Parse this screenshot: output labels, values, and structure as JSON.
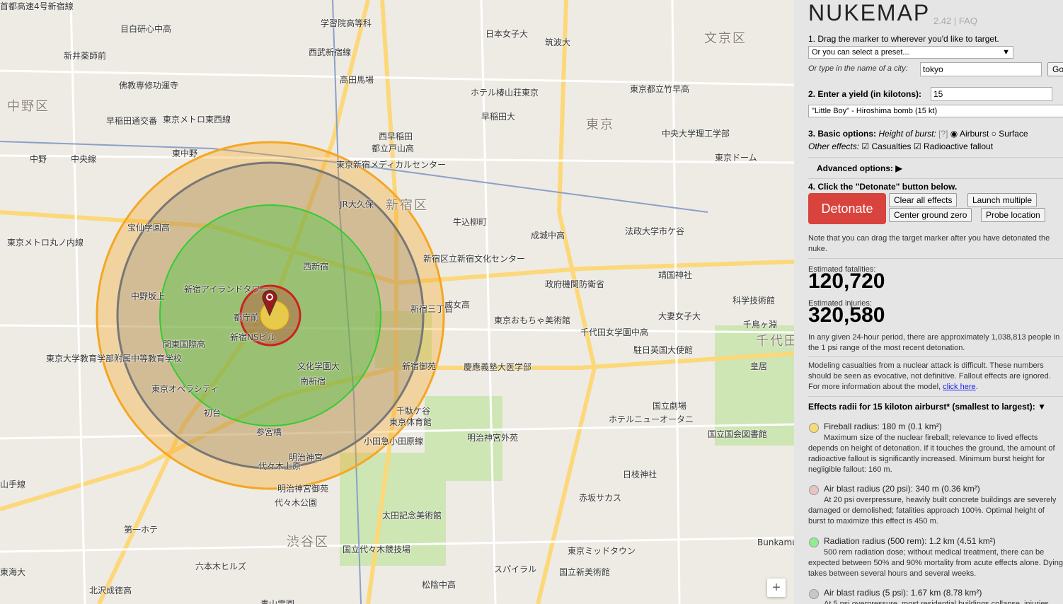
{
  "map": {
    "labels": [
      {
        "text": "中野区",
        "cls": "district"
      },
      {
        "text": "新宿区",
        "cls": "district"
      },
      {
        "text": "文京区",
        "cls": "district"
      },
      {
        "text": "渋谷区",
        "cls": "district"
      },
      {
        "text": "東京",
        "cls": "district"
      },
      {
        "text": "千代田",
        "cls": "district"
      },
      {
        "text": "目白研心中高",
        "cls": ""
      },
      {
        "text": "学習院高等科",
        "cls": ""
      },
      {
        "text": "日本女子大",
        "cls": ""
      },
      {
        "text": "筑波大",
        "cls": ""
      },
      {
        "text": "西武新宿線",
        "cls": ""
      },
      {
        "text": "新井薬師前",
        "cls": ""
      },
      {
        "text": "高田馬場",
        "cls": ""
      },
      {
        "text": "早稲田通交番",
        "cls": ""
      },
      {
        "text": "佛教専修功運寺",
        "cls": ""
      },
      {
        "text": "東京メトロ東西線",
        "cls": ""
      },
      {
        "text": "ホテル椿山荘東京",
        "cls": ""
      },
      {
        "text": "東京都立竹早高",
        "cls": ""
      },
      {
        "text": "早稲田大",
        "cls": ""
      },
      {
        "text": "中央大学理工学部",
        "cls": ""
      },
      {
        "text": "東京ドーム",
        "cls": ""
      },
      {
        "text": "都立戸山高",
        "cls": ""
      },
      {
        "text": "西早稲田",
        "cls": ""
      },
      {
        "text": "東中野",
        "cls": ""
      },
      {
        "text": "中央線",
        "cls": ""
      },
      {
        "text": "中野",
        "cls": ""
      },
      {
        "text": "東京新宿メディカルセンター",
        "cls": ""
      },
      {
        "text": "JR大久保",
        "cls": ""
      },
      {
        "text": "宝仙学園高",
        "cls": ""
      },
      {
        "text": "成城中高",
        "cls": ""
      },
      {
        "text": "牛込柳町",
        "cls": ""
      },
      {
        "text": "法政大学市ケ谷",
        "cls": ""
      },
      {
        "text": "靖国神社",
        "cls": ""
      },
      {
        "text": "東京メトロ丸ノ内線",
        "cls": ""
      },
      {
        "text": "新宿アイランドタワー",
        "cls": ""
      },
      {
        "text": "新宿区立新宿文化センター",
        "cls": ""
      },
      {
        "text": "政府機関防衛省",
        "cls": ""
      },
      {
        "text": "中野坂上",
        "cls": ""
      },
      {
        "text": "西新宿",
        "cls": ""
      },
      {
        "text": "都庁前",
        "cls": ""
      },
      {
        "text": "新宿三丁目",
        "cls": ""
      },
      {
        "text": "成女高",
        "cls": ""
      },
      {
        "text": "東京おもちゃ美術館",
        "cls": ""
      },
      {
        "text": "科学技術館",
        "cls": ""
      },
      {
        "text": "大妻女子大",
        "cls": ""
      },
      {
        "text": "千鳥ヶ淵",
        "cls": ""
      },
      {
        "text": "関東国際高",
        "cls": ""
      },
      {
        "text": "新宿NSビル",
        "cls": ""
      },
      {
        "text": "文化学園大",
        "cls": ""
      },
      {
        "text": "新宿御苑",
        "cls": ""
      },
      {
        "text": "慶應義塾大医学部",
        "cls": ""
      },
      {
        "text": "千代田女学園中高",
        "cls": ""
      },
      {
        "text": "駐日英国大使館",
        "cls": ""
      },
      {
        "text": "皇居",
        "cls": ""
      },
      {
        "text": "東京オペラシティ",
        "cls": ""
      },
      {
        "text": "南新宿",
        "cls": ""
      },
      {
        "text": "千駄ケ谷",
        "cls": ""
      },
      {
        "text": "国立劇場",
        "cls": ""
      },
      {
        "text": "東京大学教育学部附属中等教育学校",
        "cls": ""
      },
      {
        "text": "初台",
        "cls": ""
      },
      {
        "text": "参宮橋",
        "cls": ""
      },
      {
        "text": "東京体育館",
        "cls": ""
      },
      {
        "text": "明治神宮外苑",
        "cls": ""
      },
      {
        "text": "ホテルニューオータニ",
        "cls": ""
      },
      {
        "text": "国立国会図書館",
        "cls": ""
      },
      {
        "text": "明治神宮",
        "cls": ""
      },
      {
        "text": "明治神宮御苑",
        "cls": ""
      },
      {
        "text": "代々木公園",
        "cls": ""
      },
      {
        "text": "赤坂サカス",
        "cls": ""
      },
      {
        "text": "日枝神社",
        "cls": ""
      },
      {
        "text": "太田記念美術館",
        "cls": ""
      },
      {
        "text": "国立代々木競技場",
        "cls": ""
      },
      {
        "text": "東京ミッドタウン",
        "cls": ""
      },
      {
        "text": "国立新美術館",
        "cls": ""
      },
      {
        "text": "六本木ヒルズ",
        "cls": ""
      },
      {
        "text": "東海大",
        "cls": ""
      },
      {
        "text": "北沢成徳高",
        "cls": ""
      },
      {
        "text": "松陰中高",
        "cls": ""
      },
      {
        "text": "スパイラル",
        "cls": ""
      },
      {
        "text": "青山霊園",
        "cls": ""
      },
      {
        "text": "Bunkamura",
        "cls": ""
      },
      {
        "text": "第一ホテ",
        "cls": ""
      },
      {
        "text": "代々木上原",
        "cls": ""
      },
      {
        "text": "小田急小田原線",
        "cls": ""
      },
      {
        "text": "山手線",
        "cls": ""
      },
      {
        "text": "首都高速4号新宿線",
        "cls": ""
      }
    ]
  },
  "panel": {
    "title": "NUKEMAP",
    "version": "2.42",
    "faq": "FAQ",
    "step1": "1. Drag the marker to wherever you'd like to target.",
    "preset_placeholder": "Or you can select a preset...",
    "city_label": "Or type in the name of a city:",
    "city_value": "tokyo",
    "go": "Go",
    "step2": "2. Enter a yield (in kilotons):",
    "yield_value": "15",
    "yield_preset": "\"Little Boy\" - Hiroshima bomb (15 kt)",
    "step3": "3. Basic options:",
    "height_label": "Height of burst:",
    "help": "[?]",
    "airburst": "Airburst",
    "surface": "Surface",
    "other_effects": "Other effects:",
    "casualties": "Casualties",
    "fallout": "Radioactive fallout",
    "advanced": "Advanced options: ▶",
    "step4": "4. Click the \"Detonate\" button below.",
    "detonate": "Detonate",
    "clear": "Clear all effects",
    "launch": "Launch multiple",
    "center": "Center ground zero",
    "probe": "Probe location",
    "note": "Note that you can drag the target marker after you have detonated the nuke.",
    "fatalities_label": "Estimated fatalities:",
    "fatalities": "120,720",
    "injuries_label": "Estimated injuries:",
    "injuries": "320,580",
    "daily": "In any given 24-hour period, there are approximately 1,038,813 people in the 1 psi range of the most recent detonation.",
    "modeling": "Modeling casualties from a nuclear attack is difficult. These numbers should be seen as evocative, not definitive. Fallout effects are ignored. For more information about the model,",
    "click_here": "click here",
    "effects_header": "Effects radii for 15 kiloton airburst* (smallest to largest): ▼",
    "effects": [
      {
        "color": "#f7dc6f",
        "title": "Fireball radius: 180 m (0.1 km²)",
        "desc": "Maximum size of the nuclear fireball; relevance to lived effects depends on height of detonation. If it touches the ground, the amount of radioactive fallout is significantly increased. Minimum burst height for negligible fallout: 160 m."
      },
      {
        "color": "#e8c4c0",
        "title": "Air blast radius (20 psi): 340 m (0.36 km²)",
        "desc": "At 20 psi overpressure, heavily built concrete buildings are severely damaged or demolished; fatalities approach 100%. Optimal height of burst to maximize this effect is 450 m."
      },
      {
        "color": "#90ee90",
        "title": "Radiation radius (500 rem): 1.2 km (4.51 km²)",
        "desc": "500 rem radiation dose; without medical treatment, there can be expected between 50% and 90% mortality from acute effects alone. Dying takes between several hours and several weeks."
      },
      {
        "color": "#c8c8c8",
        "title": "Air blast radius (5 psi): 1.67 km (8.78 km²)",
        "desc": "At 5 psi overpressure, most residential buildings collapse, injuries"
      }
    ]
  },
  "colors": {
    "fireball": "#f2d44a",
    "blast20": "#cc2222",
    "radiation": "#33cc33",
    "blast5": "#777777",
    "thermal": "#f5a623",
    "detonate": "#d9433d"
  }
}
